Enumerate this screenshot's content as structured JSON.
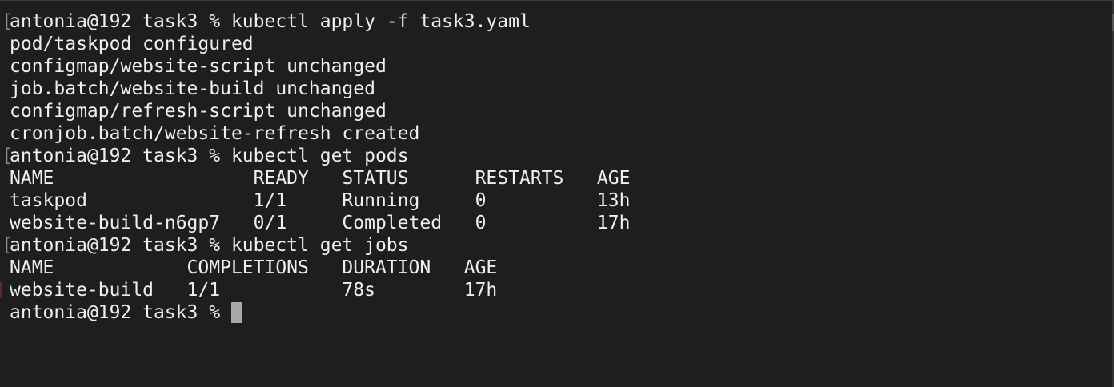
{
  "terminal": {
    "background": "#1e1e1e",
    "foreground": "#efefef",
    "cursor_color": "#a8a8a8",
    "lines": [
      {
        "text": "antonia@192 task3 % kubectl apply -f task3.yaml",
        "bracket": true
      },
      {
        "text": "pod/taskpod configured",
        "bracket": false
      },
      {
        "text": "configmap/website-script unchanged",
        "bracket": false
      },
      {
        "text": "job.batch/website-build unchanged",
        "bracket": false
      },
      {
        "text": "configmap/refresh-script unchanged",
        "bracket": false
      },
      {
        "text": "cronjob.batch/website-refresh created",
        "bracket": false
      },
      {
        "text": "antonia@192 task3 % kubectl get pods",
        "bracket": true
      },
      {
        "text": "NAME                  READY   STATUS      RESTARTS   AGE",
        "bracket": false
      },
      {
        "text": "taskpod               1/1     Running     0          13h",
        "bracket": false
      },
      {
        "text": "website-build-n6gp7   0/1     Completed   0          17h",
        "bracket": false
      },
      {
        "text": "antonia@192 task3 % kubectl get jobs",
        "bracket": true
      },
      {
        "text": "NAME            COMPLETIONS   DURATION   AGE",
        "bracket": false
      },
      {
        "text": "website-build   1/1           78s        17h",
        "bracket": false
      }
    ],
    "prompt": "antonia@192 task3 % "
  }
}
